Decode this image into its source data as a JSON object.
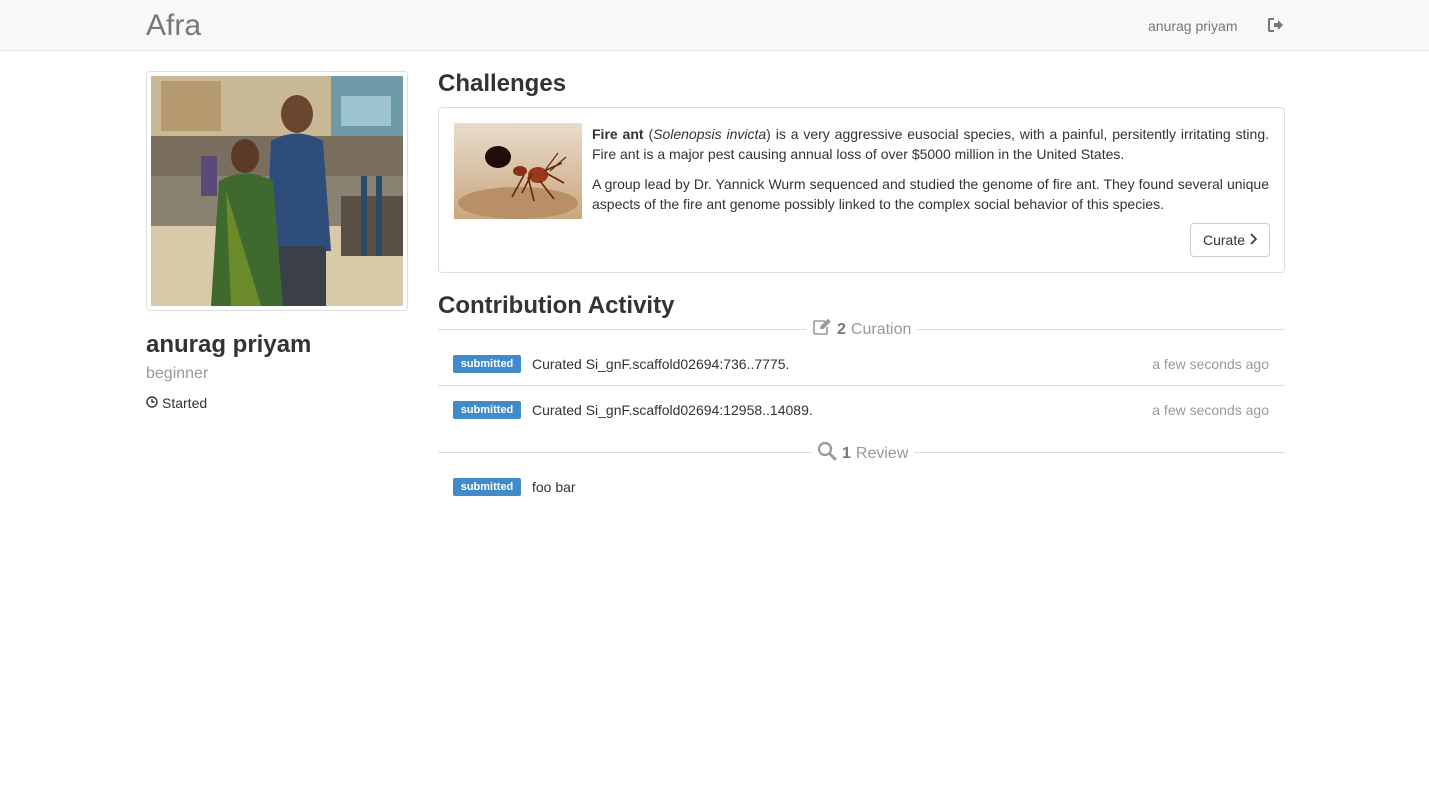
{
  "navbar": {
    "brand": "Afra",
    "user_name": "anurag priyam",
    "logout_icon": "sign-out-icon"
  },
  "profile": {
    "photo_icon": "profile-photo",
    "name": "anurag priyam",
    "level": "beginner",
    "status_icon": "clock-icon",
    "status": "Started"
  },
  "challenges": {
    "title": "Challenges",
    "ant_image": "fire-ant-photo",
    "para1_bold": "Fire ant",
    "para1_open": " (",
    "para1_italic": "Solenopsis invicta",
    "para1_rest": ") is a very aggressive eusocial species, with a painful, persitently irritating sting. Fire ant is a major pest causing annual loss of over $5000 million in the United States.",
    "para2": "A group lead by Dr. Yannick Wurm sequenced and studied the genome of fire ant. They found several unique aspects of the fire ant genome possibly linked to the complex social behavior of this species.",
    "curate_label": "Curate",
    "curate_icon": "chevron-right-icon"
  },
  "activity": {
    "title": "Contribution Activity",
    "curation": {
      "icon": "edit-icon",
      "count": "2",
      "label": "Curation",
      "items": [
        {
          "badge": "submitted",
          "text": "Curated Si_gnF.scaffold02694:736..7775.",
          "time": "a few seconds ago"
        },
        {
          "badge": "submitted",
          "text": "Curated Si_gnF.scaffold02694:12958..14089.",
          "time": "a few seconds ago"
        }
      ]
    },
    "review": {
      "icon": "search-icon",
      "count": "1",
      "label": "Review",
      "items": [
        {
          "badge": "submitted",
          "text": "foo bar",
          "time": ""
        }
      ]
    }
  },
  "colors": {
    "navbar_bg": "#f8f8f8",
    "badge": "#428bca",
    "muted_text": "#999999"
  }
}
